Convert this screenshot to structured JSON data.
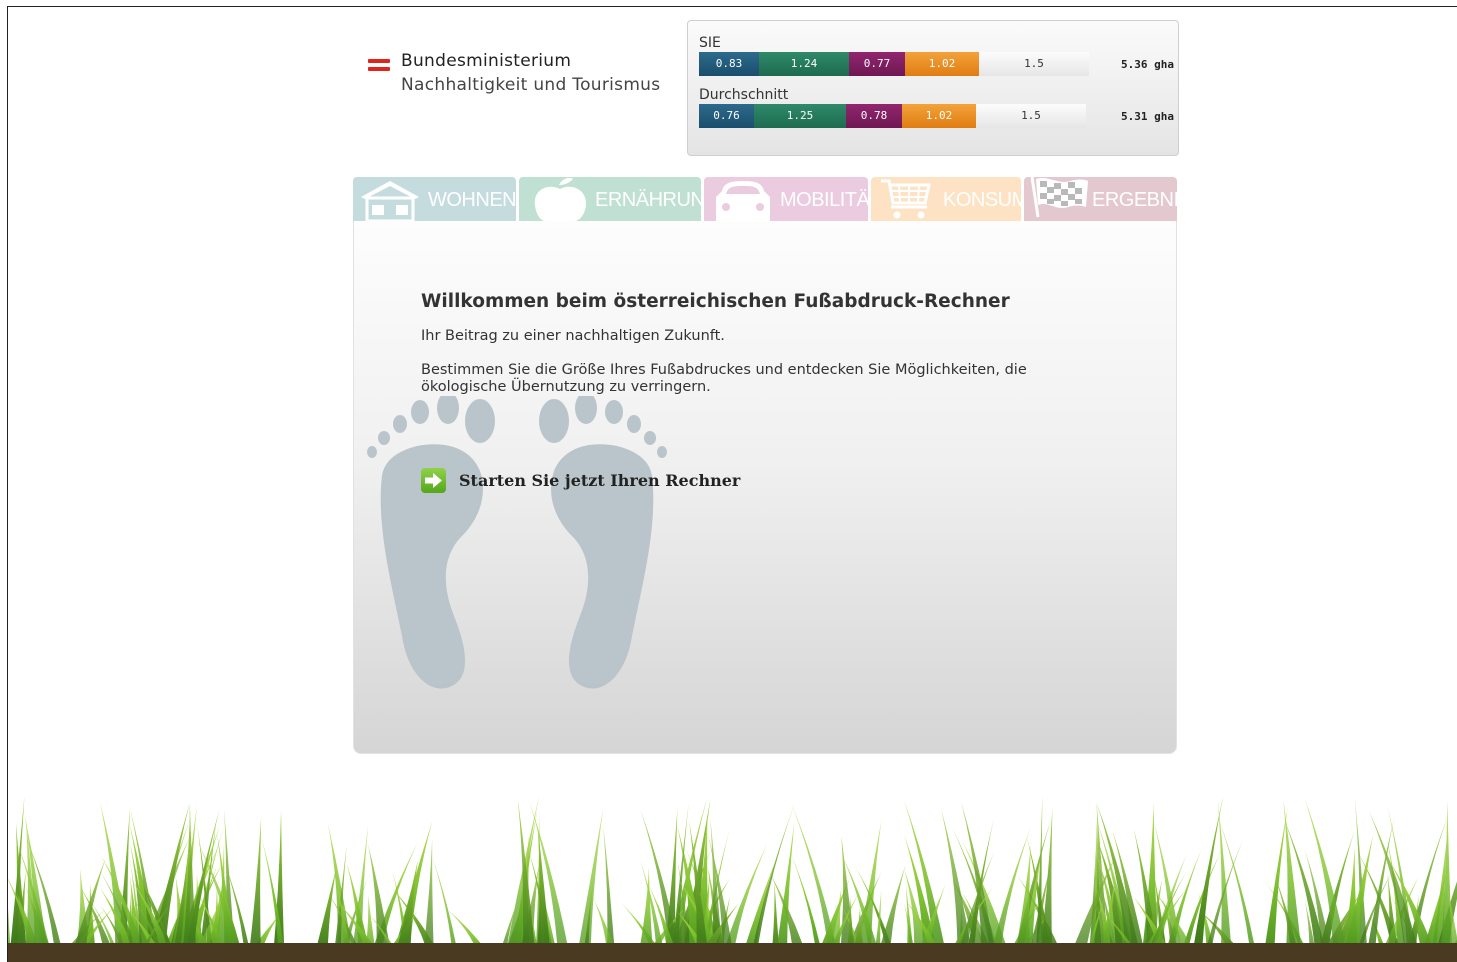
{
  "logo": {
    "line1": "Bundesministerium",
    "line2": "Nachhaltigkeit und Tourismus",
    "flag_color": "#e2231a"
  },
  "score_panel": {
    "rows": [
      {
        "label": "SIE",
        "segments": [
          "0.83",
          "1.24",
          "0.77",
          "1.02",
          "1.5"
        ],
        "total": "5.36 gha"
      },
      {
        "label": "Durchschnitt",
        "segments": [
          "0.76",
          "1.25",
          "0.78",
          "1.02",
          "1.5"
        ],
        "total": "5.31 gha"
      }
    ],
    "segment_colors": [
      "#1f5676",
      "#237659",
      "#7e1c60",
      "#ec8c22",
      "#efefef"
    ]
  },
  "tabs": [
    {
      "label": "WOHNEN",
      "icon": "house-icon"
    },
    {
      "label": "ERNÄHRUNG",
      "icon": "apple-icon"
    },
    {
      "label": "MOBILITÄT",
      "icon": "car-icon"
    },
    {
      "label": "KONSUM",
      "icon": "cart-icon"
    },
    {
      "label": "ERGEBNIS",
      "icon": "checkered-flag-icon"
    }
  ],
  "main": {
    "title": "Willkommen beim österreichischen Fußabdruck-Rechner",
    "subtitle": "Ihr Beitrag zu einer nachhaltigen Zukunft.",
    "description": "Bestimmen Sie die Größe Ihres Fußabdruckes und entdecken Sie Möglichkeiten, die ökologische Übernutzung zu verringern.",
    "start_label": "Starten Sie jetzt Ihren Rechner",
    "start_icon": "arrow-right-icon"
  },
  "colors": {
    "accent_green": "#6cbf2a",
    "footprint": "#b7c3c9"
  }
}
